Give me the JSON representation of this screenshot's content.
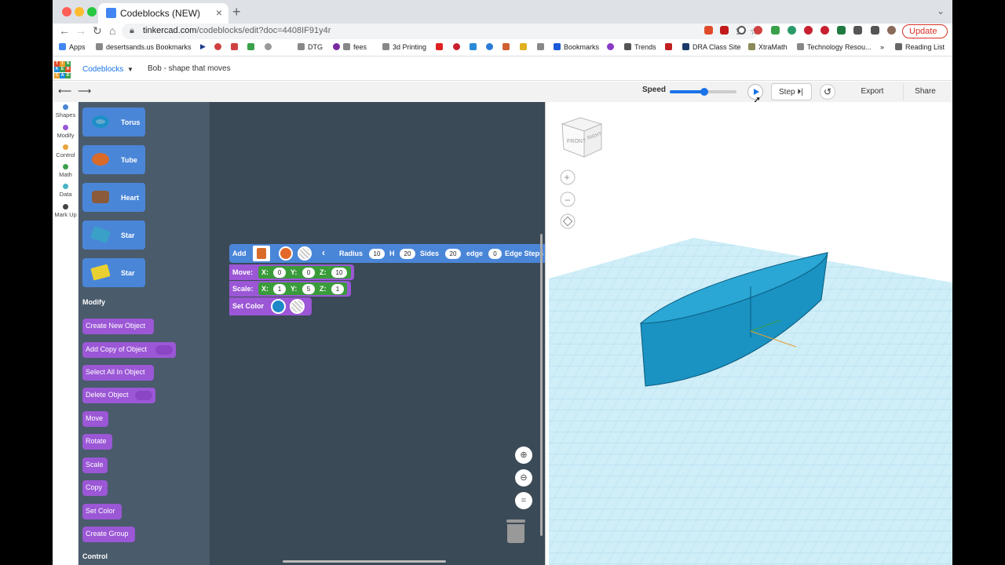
{
  "browser": {
    "tab_title": "Codeblocks (NEW)",
    "url_domain": "tinkercad.com",
    "url_path": "/codeblocks/edit?doc=4408IF91y4r",
    "update_label": "Update",
    "bookmarks": [
      "Apps",
      "desertsands.us Bookmarks",
      "DTG",
      "fees",
      "3d Printing",
      "Bookmarks",
      "Trends",
      "DRA Class Site",
      "XtraMath",
      "Technology Resou...",
      "Reading List"
    ]
  },
  "header": {
    "logo_letters": [
      "T",
      "I",
      "N",
      "K",
      "E",
      "R",
      "C",
      "A",
      "D"
    ],
    "app_name": "Codeblocks",
    "doc_name": "Bob - shape that moves"
  },
  "toolbar": {
    "speed_label": "Speed",
    "speed_value": 0.52,
    "step_label": "Step",
    "export_label": "Export",
    "share_label": "Share"
  },
  "categories": [
    {
      "label": "Shapes",
      "color": "#4a86d8"
    },
    {
      "label": "Modify",
      "color": "#9b57d6"
    },
    {
      "label": "Control",
      "color": "#e8a33a"
    },
    {
      "label": "Math",
      "color": "#3aa04a"
    },
    {
      "label": "Data",
      "color": "#49b3c6"
    },
    {
      "label": "Mark Up",
      "color": "#444444"
    }
  ],
  "flyout": {
    "shapes": [
      {
        "label": "Torus",
        "color": "#1f8fc9"
      },
      {
        "label": "Tube",
        "color": "#d86a2a"
      },
      {
        "label": "Heart",
        "color": "#8a5a3a"
      },
      {
        "label": "Star",
        "color": "#3aa0c8"
      },
      {
        "label": "Star",
        "color": "#e8d030"
      }
    ],
    "modify_heading": "Modify",
    "modify_blocks": [
      "Create New Object",
      "Add Copy of Object",
      "Select All In Object",
      "Delete Object",
      "Move",
      "Rotate",
      "Scale",
      "Copy",
      "Set Color",
      "Create Group"
    ],
    "control_heading": "Control"
  },
  "workspace": {
    "add": {
      "label": "Add",
      "radius_label": "Radius",
      "radius": "10",
      "h_label": "H",
      "h": "20",
      "sides_label": "Sides",
      "sides": "20",
      "edge_label": "edge",
      "edge": "0",
      "edge_steps_label": "Edge Steps"
    },
    "move": {
      "label": "Move:",
      "x_label": "X:",
      "x": "0",
      "y_label": "Y:",
      "y": "0",
      "z_label": "Z:",
      "z": "10"
    },
    "scale": {
      "label": "Scale:",
      "x_label": "X:",
      "x": "1",
      "y_label": "Y:",
      "y": "5",
      "z_label": "Z:",
      "z": "1"
    },
    "set_color": {
      "label": "Set Color",
      "color": "#1e88c8"
    }
  },
  "viewcube": {
    "front": "FRONT",
    "right": "RIGHT"
  },
  "colors": {
    "shape_blue": "#4a86d8",
    "modify_purple": "#9b57d6",
    "grid": "#bfe3f0",
    "object": "#1a92c2"
  }
}
